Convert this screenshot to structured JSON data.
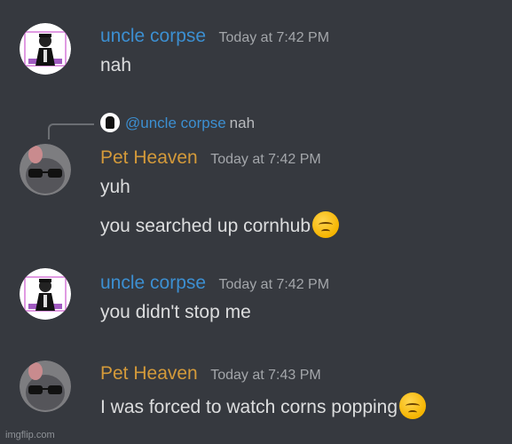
{
  "messages": [
    {
      "username": "uncle corpse",
      "username_color": "#3c8fd1",
      "timestamp": "Today at 7:42 PM",
      "lines": [
        "nah"
      ]
    },
    {
      "reply": {
        "mention": "@uncle corpse",
        "text": "nah"
      },
      "username": "Pet Heaven",
      "username_color": "#d49a3a",
      "timestamp": "Today at 7:42 PM",
      "lines": [
        "yuh",
        "you searched up cornhub"
      ],
      "emoji": "pensive-face"
    },
    {
      "username": "uncle corpse",
      "username_color": "#3c8fd1",
      "timestamp": "Today at 7:42 PM",
      "lines": [
        "you didn't stop me"
      ]
    },
    {
      "username": "Pet Heaven",
      "username_color": "#d49a3a",
      "timestamp": "Today at 7:43 PM",
      "lines": [
        "I was forced to watch corns popping"
      ],
      "emoji": "pensive-face"
    }
  ],
  "watermark": "imgflip.com",
  "colors": {
    "background": "#36393f",
    "text": "#dcddde",
    "timestamp": "#a3a6aa"
  }
}
